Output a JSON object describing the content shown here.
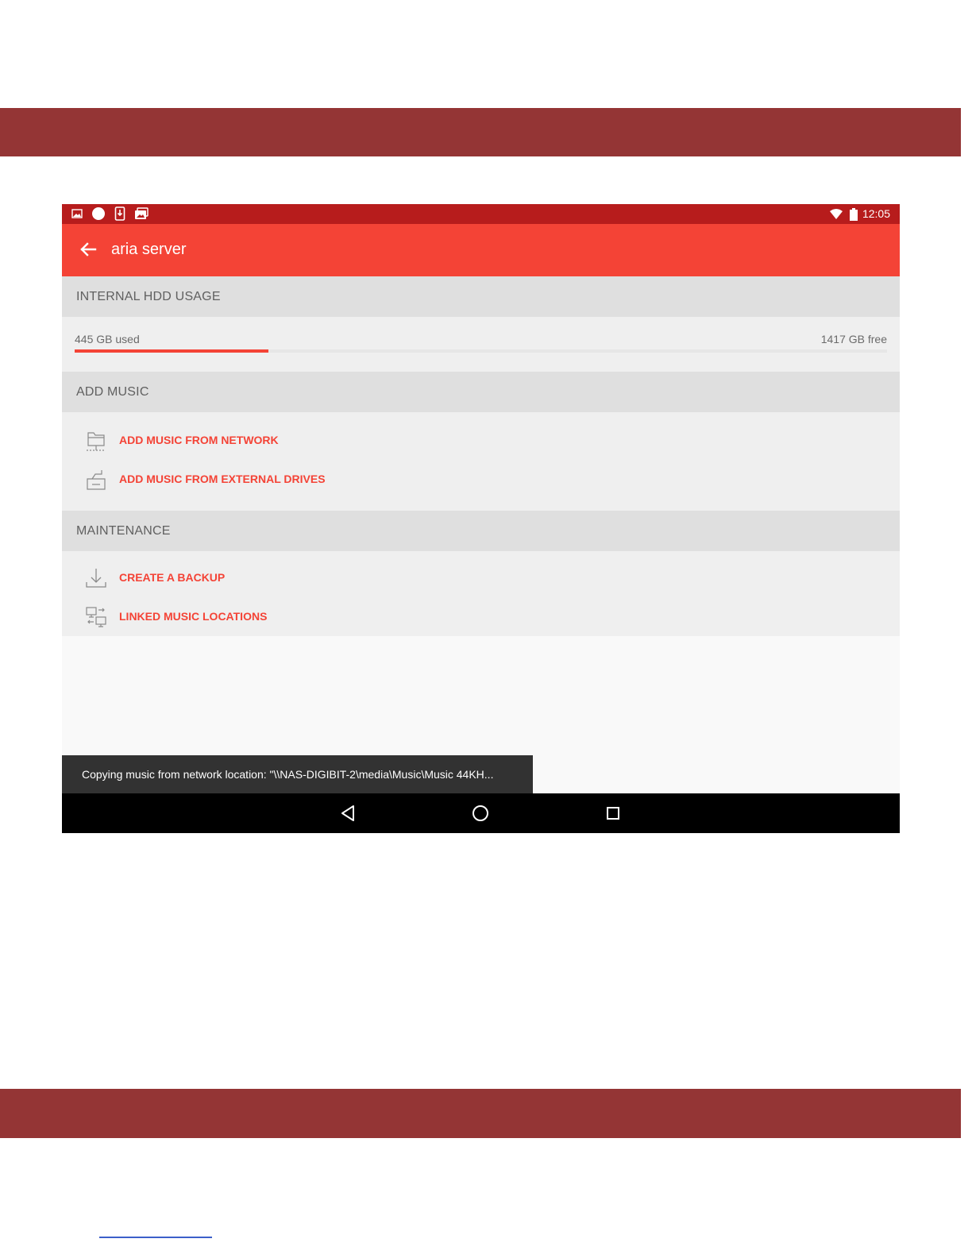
{
  "status_bar": {
    "time": "12:05",
    "icons": [
      "image-icon",
      "circle-icon",
      "download-icon",
      "photos-icon",
      "wifi-icon",
      "battery-icon"
    ]
  },
  "app_bar": {
    "title": "aria server",
    "back_icon": "arrow-left-icon"
  },
  "sections": {
    "hdd": {
      "header": "INTERNAL HDD USAGE",
      "used": "445 GB used",
      "free": "1417 GB free",
      "used_fraction": 0.239
    },
    "add_music": {
      "header": "ADD MUSIC",
      "items": [
        {
          "label": "ADD MUSIC FROM NETWORK",
          "icon": "network-folder-icon"
        },
        {
          "label": "ADD MUSIC FROM EXTERNAL DRIVES",
          "icon": "external-drive-icon"
        }
      ]
    },
    "maintenance": {
      "header": "MAINTENANCE",
      "items": [
        {
          "label": "CREATE A BACKUP",
          "icon": "download-tray-icon"
        },
        {
          "label": "LINKED MUSIC LOCATIONS",
          "icon": "linked-computers-icon"
        }
      ]
    }
  },
  "snackbar": {
    "message": "Copying music from network location: \"\\\\NAS-DIGIBIT-2\\media\\Music\\Music 44KH..."
  },
  "nav_bar": {
    "buttons": [
      "back-triangle-icon",
      "home-circle-icon",
      "recents-square-icon"
    ]
  },
  "colors": {
    "page_band": "#943535",
    "status_bar": "#b71c1c",
    "app_bar": "#f44336",
    "accent": "#f44336",
    "section_header_bg": "#dfdfdf",
    "section_body_bg": "#efefef",
    "snackbar_bg": "#323232",
    "nav_bar_bg": "#000000"
  }
}
